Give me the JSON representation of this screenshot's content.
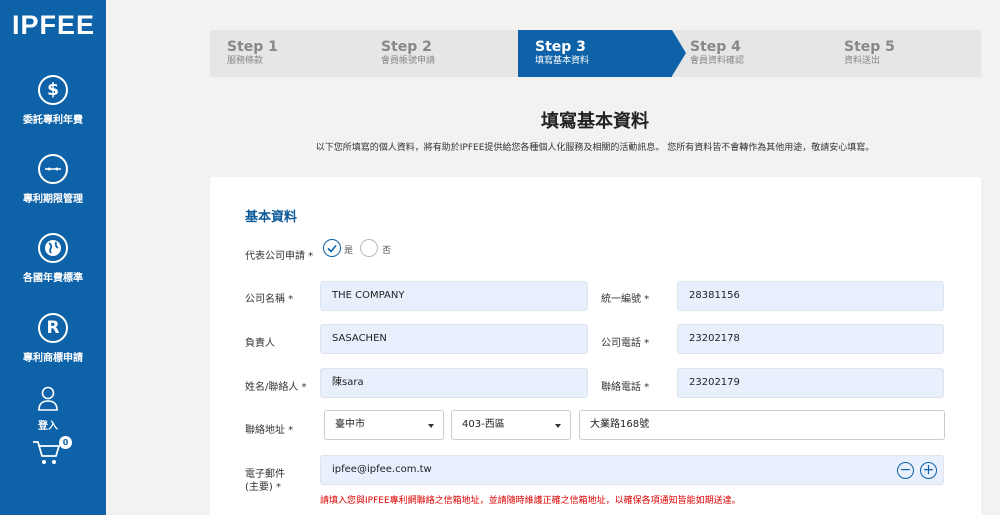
{
  "sidebar": {
    "logo": "IPFEE",
    "items": [
      {
        "label": "委託專利年費",
        "icon": "dollar-icon"
      },
      {
        "label": "專利期限管理",
        "icon": "calendar-clock-icon"
      },
      {
        "label": "各國年費標準",
        "icon": "globe-icon"
      },
      {
        "label": "專利商標申請",
        "icon": "registered-icon"
      }
    ],
    "login_label": "登入",
    "cart_count": "0"
  },
  "stepper": {
    "steps": [
      {
        "title": "Step 1",
        "sub": "服務條款"
      },
      {
        "title": "Step 2",
        "sub": "會員帳號申請"
      },
      {
        "title": "Step 3",
        "sub": "填寫基本資料"
      },
      {
        "title": "Step 4",
        "sub": "會員資料確認"
      },
      {
        "title": "Step 5",
        "sub": "資料送出"
      }
    ],
    "active_index": 2
  },
  "page": {
    "title": "填寫基本資料",
    "intro": "以下您所填寫的個人資料，將有助於IPFEE提供給您各種個人化服務及相關的活動訊息。 您所有資料皆不會轉作為其他用途，敬請安心填寫。"
  },
  "form": {
    "section_title": "基本資料",
    "company_apply": {
      "label": "代表公司申請 *",
      "yes": "是",
      "no": "否",
      "selected": "yes"
    },
    "company_name": {
      "label": "公司名稱 *",
      "value": "THE COMPANY"
    },
    "tax_id": {
      "label": "統一編號 *",
      "value": "28381156"
    },
    "owner": {
      "label": "負責人",
      "value": "SASACHEN"
    },
    "company_phone": {
      "label": "公司電話 *",
      "value": "23202178"
    },
    "contact_name": {
      "label": "姓名/聯絡人 *",
      "value": "陳sara"
    },
    "contact_phone": {
      "label": "聯絡電話 *",
      "value": "23202179"
    },
    "address": {
      "label": "聯絡地址 *",
      "city": "臺中市",
      "district": "403-西區",
      "street": "大業路168號"
    },
    "email": {
      "label_1": "電子郵件",
      "label_2": "(主要) *",
      "value": "ipfee@ipfee.com.tw",
      "remove": "−",
      "add": "+",
      "hint": "請填入您與IPFEE專利網聯絡之信箱地址，並請隨時維護正確之信箱地址，以確保各項通知皆能如期送達。"
    }
  },
  "colors": {
    "brand": "#0d62a8",
    "hint": "#dd0000",
    "field_bg": "#e8f0fe"
  }
}
